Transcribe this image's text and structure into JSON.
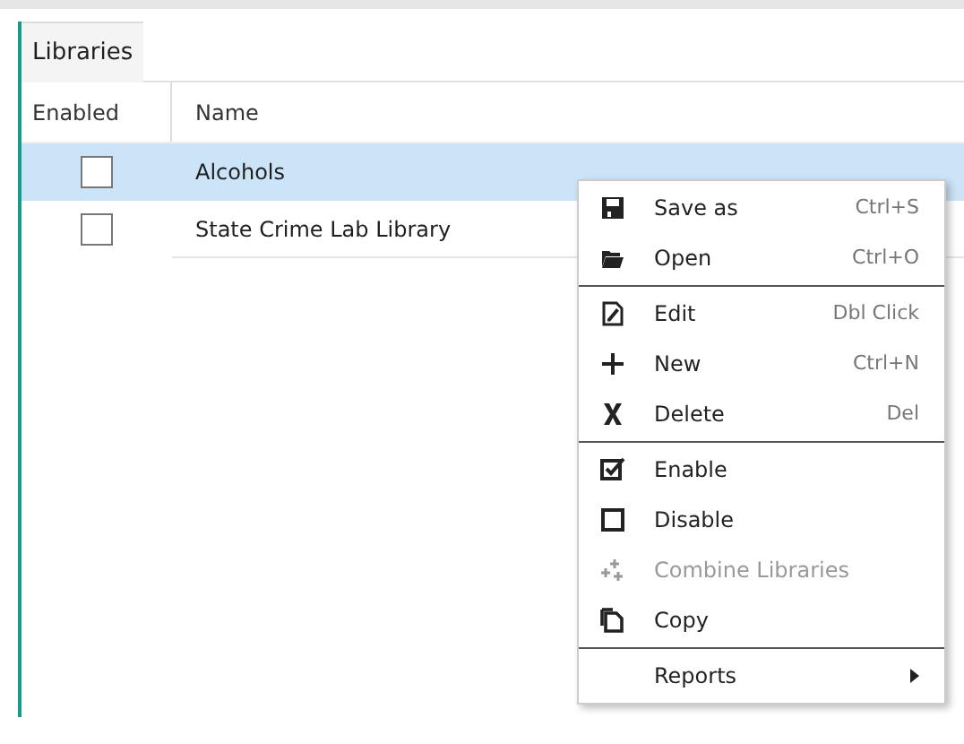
{
  "tab": {
    "label": "Libraries",
    "selected": true
  },
  "table": {
    "columns": [
      "Enabled",
      "Name"
    ],
    "rows": [
      {
        "enabled": false,
        "name": "Alcohols",
        "selected": true
      },
      {
        "enabled": false,
        "name": "State Crime Lab Library",
        "selected": false
      }
    ]
  },
  "context_menu": {
    "sections": [
      [
        {
          "kind": "item",
          "label": "Save as",
          "shortcut": "Ctrl+S",
          "disabled": false
        },
        {
          "kind": "item",
          "label": "Open",
          "shortcut": "Ctrl+O",
          "disabled": false
        }
      ],
      [
        {
          "kind": "item",
          "label": "Edit",
          "shortcut": "Dbl Click",
          "disabled": false
        },
        {
          "kind": "item",
          "label": "New",
          "shortcut": "Ctrl+N",
          "disabled": false
        },
        {
          "kind": "item",
          "label": "Delete",
          "shortcut": "Del",
          "disabled": false
        }
      ],
      [
        {
          "kind": "item",
          "label": "Enable",
          "disabled": false
        },
        {
          "kind": "item",
          "label": "Disable",
          "disabled": false
        },
        {
          "kind": "item",
          "label": "Combine Libraries",
          "disabled": true
        },
        {
          "kind": "item",
          "label": "Copy",
          "disabled": false
        }
      ],
      [
        {
          "kind": "submenu",
          "label": "Reports",
          "disabled": false
        }
      ]
    ]
  }
}
